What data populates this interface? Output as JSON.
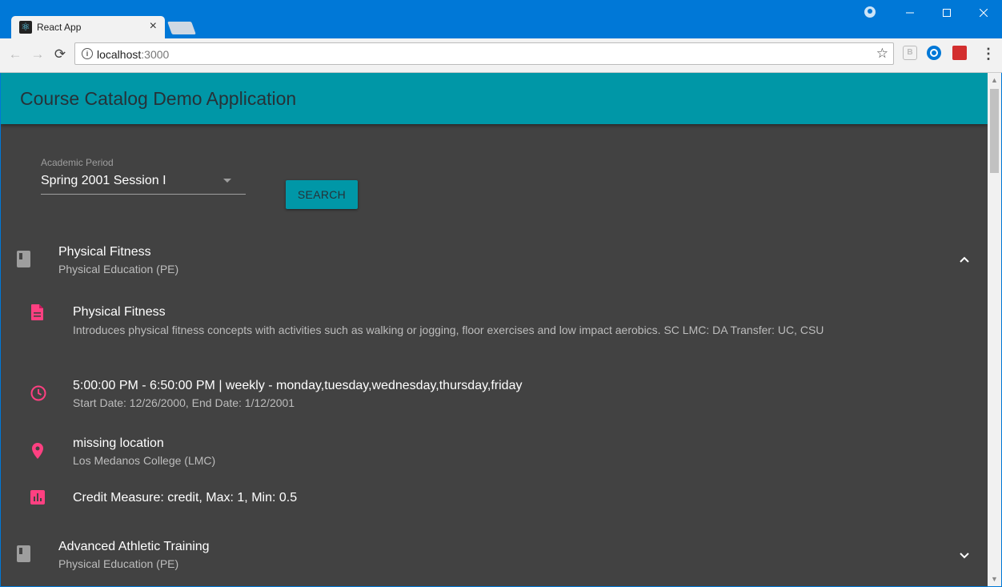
{
  "browser": {
    "tab_title": "React App",
    "url_host": "localhost",
    "url_port": ":3000",
    "ext1_label": "B",
    "accent": "#0078d7"
  },
  "app": {
    "title": "Course Catalog Demo Application",
    "appbar_color": "#0097a7",
    "background": "#424242"
  },
  "filter": {
    "label": "Academic Period",
    "value": "Spring 2001 Session I",
    "search_label": "SEARCH"
  },
  "courses": [
    {
      "title": "Physical Fitness",
      "subject": "Physical Education (PE)",
      "expanded": true,
      "details": {
        "description_title": "Physical Fitness",
        "description": "Introduces physical fitness concepts with activities such as walking or jogging, floor exercises and low impact aerobics. SC LMC: DA Transfer: UC, CSU",
        "schedule": "5:00:00 PM - 6:50:00 PM | weekly - monday,tuesday,wednesday,thursday,friday",
        "dates": "Start Date: 12/26/2000, End Date: 1/12/2001",
        "location": "missing location",
        "campus": "Los Medanos College (LMC)",
        "credit": "Credit Measure: credit, Max: 1, Min: 0.5"
      }
    },
    {
      "title": "Advanced Athletic Training",
      "subject": "Physical Education (PE)",
      "expanded": false
    }
  ],
  "icon_color": "#ff4081"
}
